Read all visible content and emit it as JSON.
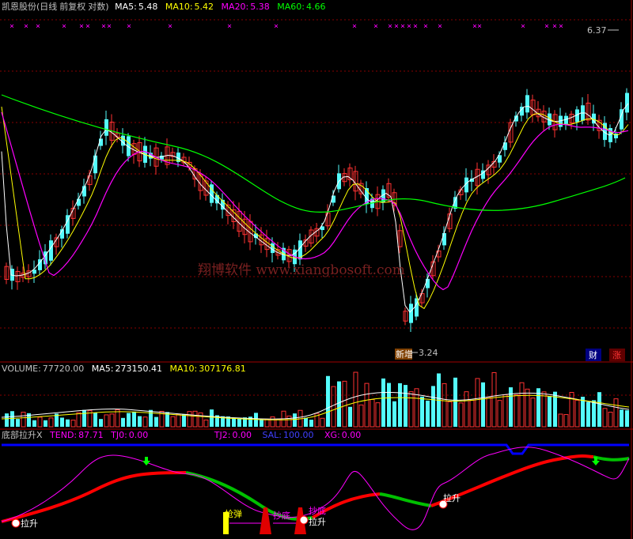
{
  "stock": {
    "name": "凯恩股份",
    "period": "日线",
    "adjust": "前复权",
    "scale": "对数"
  },
  "price_panel": {
    "ma5_label": "MA5:",
    "ma5": "5.48",
    "ma10_label": "MA10:",
    "ma10": "5.42",
    "ma20_label": "MA20:",
    "ma20": "5.38",
    "ma60_label": "MA60:",
    "ma60": "4.66",
    "high_marker": "6.37",
    "low_marker": "3.24",
    "low_tag": "新增",
    "badge_cai": "财",
    "badge_zhang": "涨",
    "watermark": "翔博软件 www.xiangbosoft.com"
  },
  "volume_panel": {
    "vol_label": "VOLUME:",
    "vol": "77720.00",
    "ma5_label": "MA5:",
    "ma5": "273150.41",
    "ma10_label": "MA10:",
    "ma10": "307176.81"
  },
  "indicator_panel": {
    "name": "底部拉升X",
    "tend_label": "TEND:",
    "tend": "87.71",
    "tj0_label": "TJ0:",
    "tj0": "0.00",
    "tj2_label": "TJ2:",
    "tj2": "0.00",
    "sal_label": "SAL:",
    "sal": "100.00",
    "xg_label": "XG:",
    "xg": "0.00",
    "signal_lasheng": "拉升",
    "signal_qiangdan": "抢弹",
    "signal_chaodi": "抄底"
  },
  "colors": {
    "up": "#ff3232",
    "down": "#54fcfc",
    "ma5": "#ffffff",
    "ma10": "#ffff00",
    "ma20": "#ff00ff",
    "ma60": "#00ff00",
    "grid": "#880000",
    "title": "#c0c0c0",
    "blue_line": "#0000ff",
    "trend_up": "#ff0000",
    "trend_down": "#00c000",
    "magenta": "#ff00ff"
  }
}
